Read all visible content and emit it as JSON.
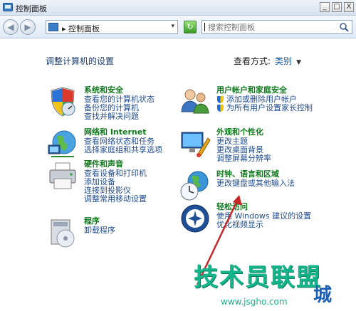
{
  "window": {
    "title": "控制面板",
    "buttons": {
      "minimize": "_",
      "maximize": "□",
      "close": "X"
    }
  },
  "nav": {
    "address_crumb": "▸ 控制面板",
    "address_drop": "▾",
    "refresh": "↻",
    "search_placeholder": "搜索控制面板"
  },
  "content": {
    "heading": "调整计算机的设置",
    "view_by_label": "查看方式:",
    "view_by_value": "类别",
    "view_by_caret": "▼"
  },
  "left_categories": [
    {
      "title": "系统和安全",
      "icon": "shield-icon",
      "links": [
        "查看您的计算机状态",
        "备份您的计算机",
        "查找并解决问题"
      ]
    },
    {
      "title": "网络和 Internet",
      "icon": "network-icon",
      "links": [
        "查看网络状态和任务",
        "选择家庭组和共享选项"
      ]
    },
    {
      "title": "硬件和声音",
      "icon": "printer-icon",
      "links": [
        "查看设备和打印机",
        "添加设备",
        "连接到投影仪",
        "调整常用移动设置"
      ]
    },
    {
      "title": "程序",
      "icon": "programs-icon",
      "links": [
        "卸载程序"
      ]
    }
  ],
  "right_categories": [
    {
      "title": "用户帐户和家庭安全",
      "icon": "users-icon",
      "links": [
        "添加或删除用户帐户",
        "为所有用户设置家长控制"
      ]
    },
    {
      "title": "外观和个性化",
      "icon": "appearance-icon",
      "links": [
        "更改主题",
        "更改桌面背景",
        "调整屏幕分辨率"
      ]
    },
    {
      "title": "时钟、语言和区域",
      "icon": "clock-globe-icon",
      "links": [
        "更改键盘或其他输入法"
      ]
    },
    {
      "title": "轻松访问",
      "icon": "ease-of-access-icon",
      "links": [
        "使用 Windows 建议的设置",
        "优化视频显示"
      ]
    }
  ],
  "watermark": {
    "text": "技术员联盟",
    "tail": "城",
    "url": "www.jsgho.com"
  }
}
